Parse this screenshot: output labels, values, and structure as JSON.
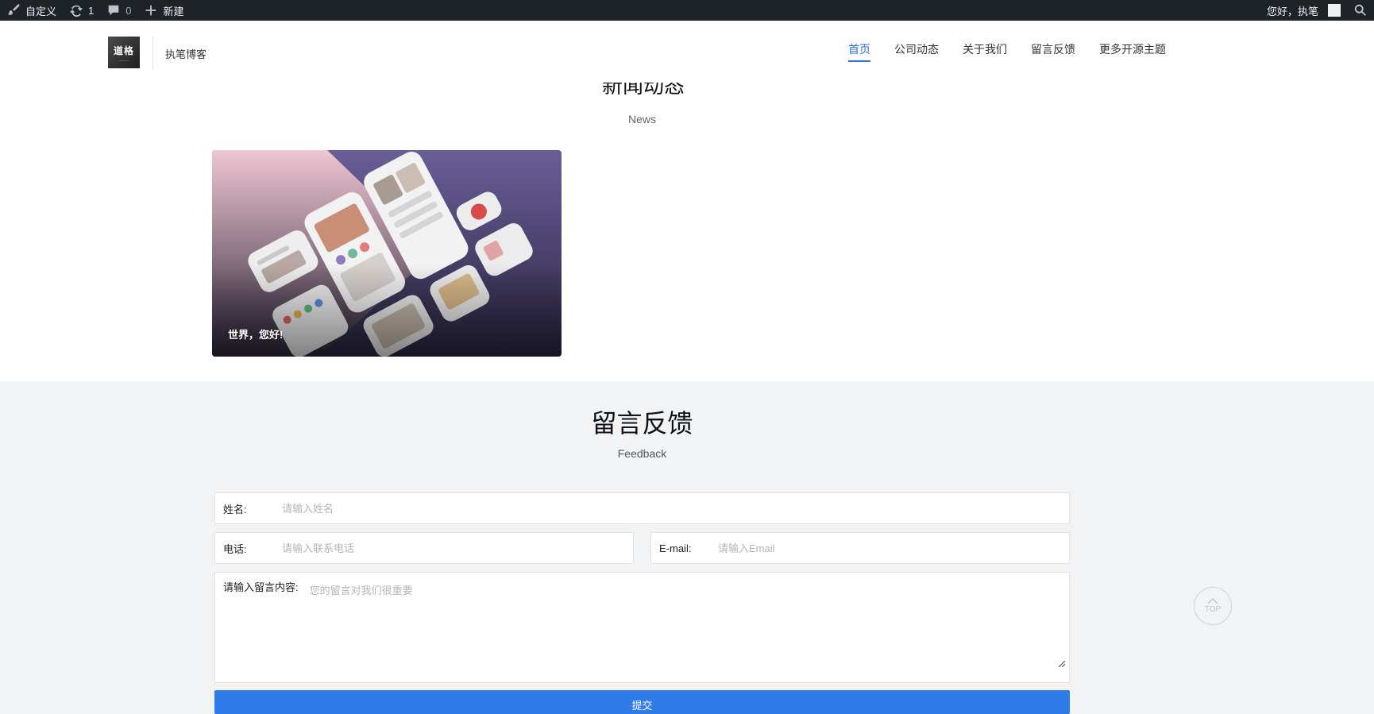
{
  "adminbar": {
    "customize_label": "自定义",
    "updates_count": "1",
    "comments_count": "0",
    "new_label": "新建",
    "greeting": "您好，执笔"
  },
  "header": {
    "logo_text": "道格",
    "site_name": "执笔博客",
    "nav": [
      {
        "label": "首页",
        "active": true
      },
      {
        "label": "公司动态"
      },
      {
        "label": "关于我们"
      },
      {
        "label": "留言反馈"
      },
      {
        "label": "更多开源主题"
      }
    ]
  },
  "news": {
    "title": "新闻动态",
    "subtitle": "News",
    "card_caption": "世界，您好!"
  },
  "feedback": {
    "title": "留言反馈",
    "subtitle": "Feedback",
    "name_label": "姓名:",
    "name_placeholder": "请输入姓名",
    "phone_label": "电话:",
    "phone_placeholder": "请输入联系电话",
    "email_label": "E-mail:",
    "email_placeholder": "请输入Email",
    "message_label": "请输入留言内容:",
    "message_placeholder": "您的留言对我们很重要",
    "submit_label": "提交"
  },
  "top_button": {
    "label": "TOP"
  },
  "colors": {
    "accent": "#2b6fd8",
    "adminbar": "#1d2327",
    "submit": "#2f7be8"
  }
}
